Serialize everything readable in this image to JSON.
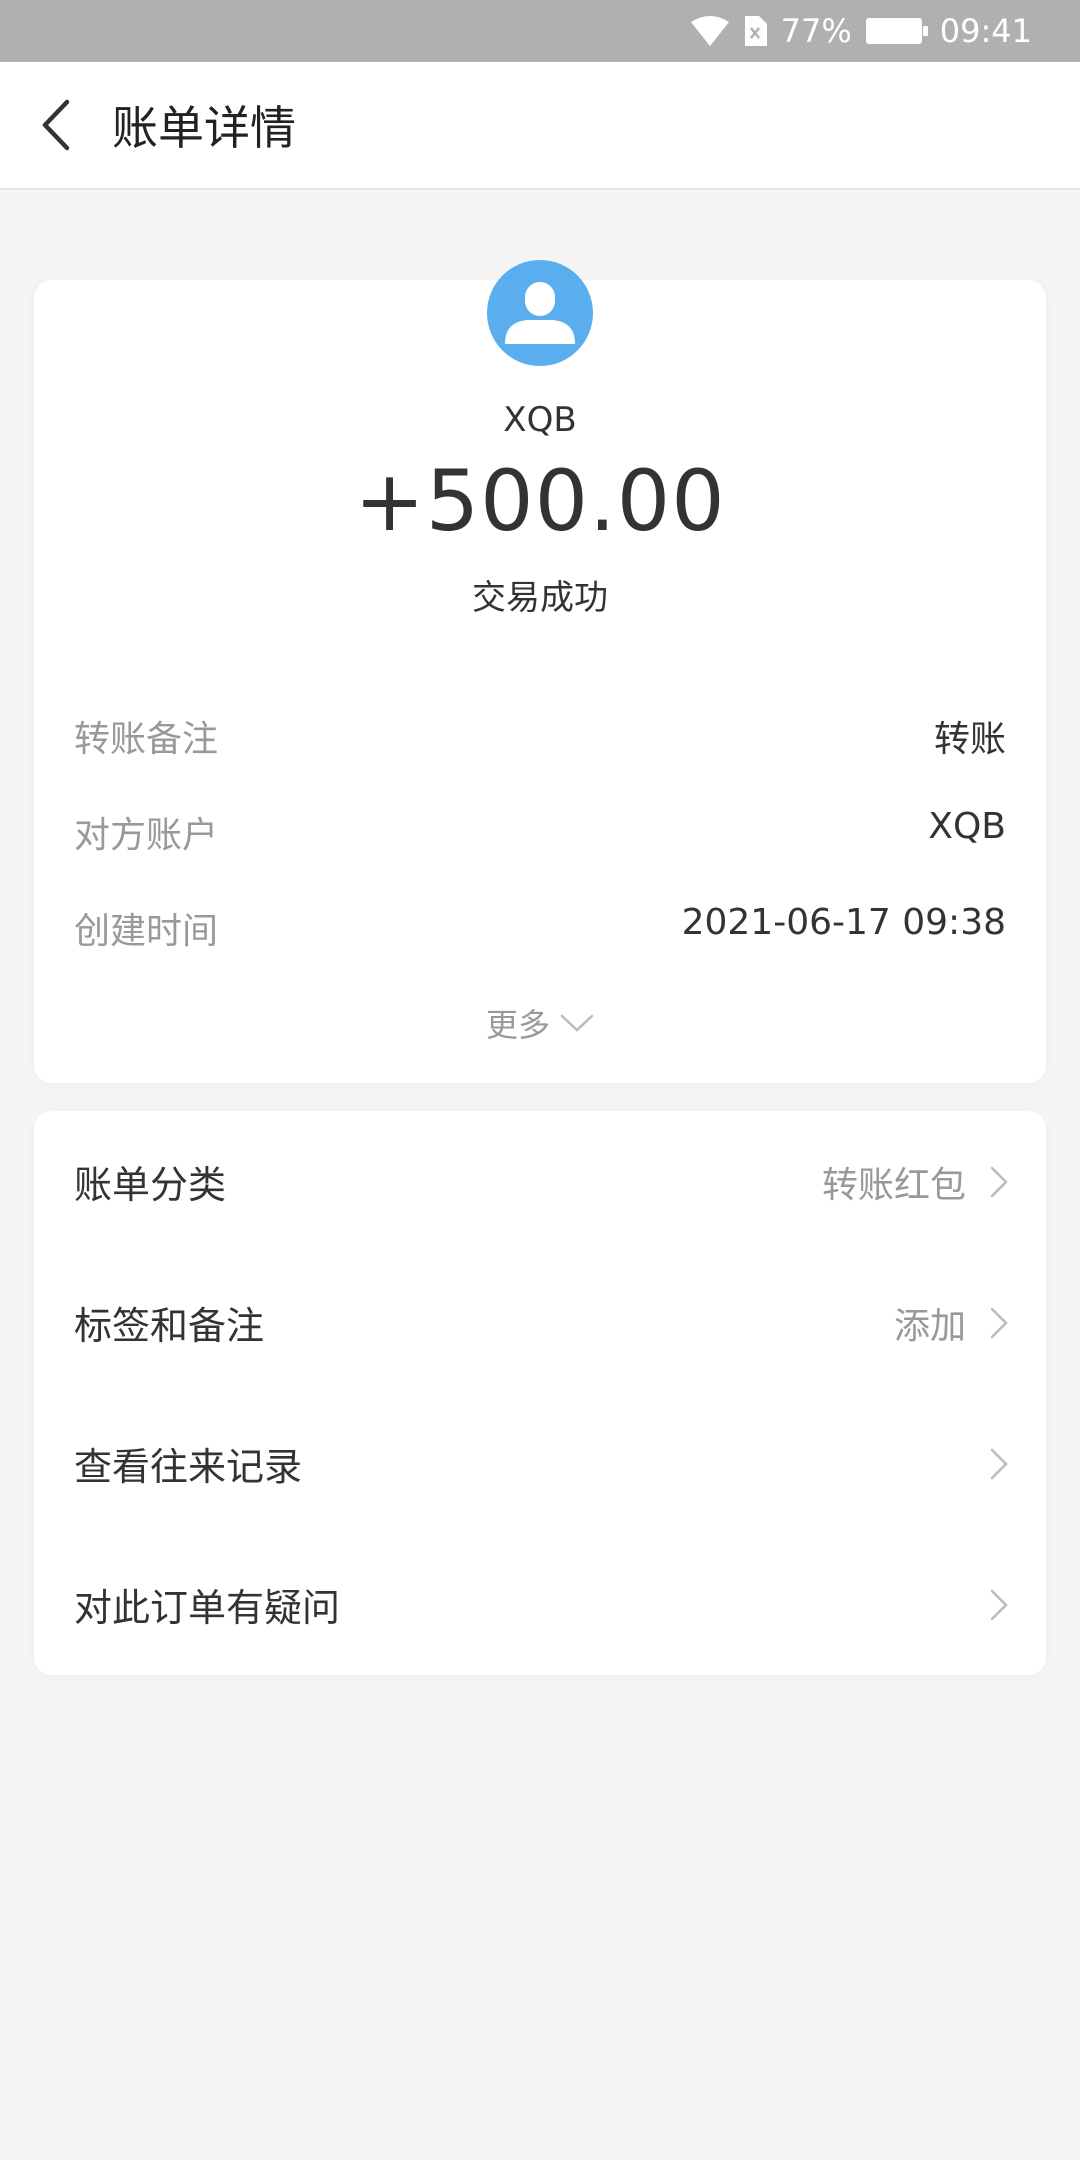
{
  "status_bar": {
    "battery_percent": "77%",
    "time": "09:41"
  },
  "nav": {
    "title": "账单详情"
  },
  "summary": {
    "payee": "XQB",
    "amount": "+500.00",
    "status": "交易成功",
    "avatar_color": "#5aaeee",
    "details": [
      {
        "label": "转账备注",
        "value": "转账"
      },
      {
        "label": "对方账户",
        "value": "XQB"
      },
      {
        "label": "创建时间",
        "value": "2021-06-17 09:38"
      }
    ],
    "more_label": "更多"
  },
  "menu": {
    "items": [
      {
        "label": "账单分类",
        "value": "转账红包"
      },
      {
        "label": "标签和备注",
        "value": "添加"
      },
      {
        "label": "查看往来记录",
        "value": ""
      },
      {
        "label": "对此订单有疑问",
        "value": ""
      }
    ]
  }
}
